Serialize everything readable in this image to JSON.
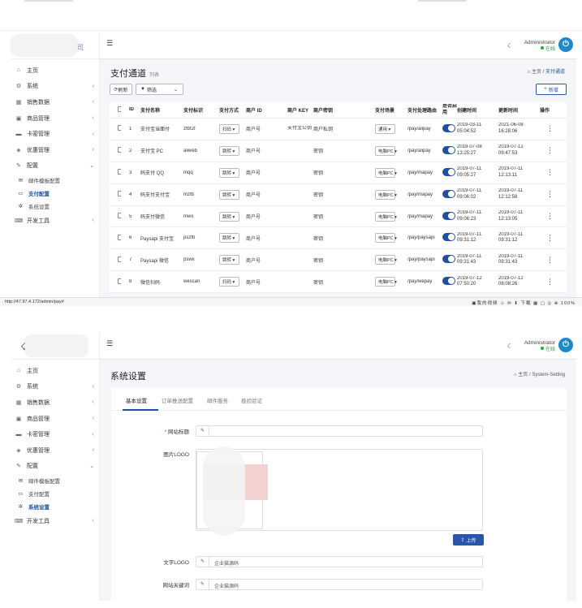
{
  "status_url": "http://47.97.4.172/admin/pay#",
  "status_right": "我的视频",
  "status_zoom_label": "下载",
  "zoom": "100%",
  "header": {
    "admin_name": "Administrator",
    "admin_status": "在线"
  },
  "sidebar": {
    "logo_char": "司",
    "items": [
      {
        "icon": "home-icon",
        "glyph": "⌂",
        "label": "主页"
      },
      {
        "icon": "gear-icon",
        "glyph": "⚙",
        "label": "系统"
      },
      {
        "icon": "table-icon",
        "glyph": "▦",
        "label": "销售数据"
      },
      {
        "icon": "box-icon",
        "glyph": "▣",
        "label": "商品管理"
      },
      {
        "icon": "card-icon",
        "glyph": "▬",
        "label": "卡密管理"
      },
      {
        "icon": "gem-icon",
        "glyph": "◈",
        "label": "优惠管理"
      },
      {
        "icon": "wrench-icon",
        "glyph": "✎",
        "label": "配置"
      }
    ],
    "subitems": [
      {
        "icon": "mail-icon",
        "glyph": "✉",
        "label": "邮件模板配置"
      },
      {
        "icon": "pay-icon",
        "glyph": "▭",
        "label": "支付配置"
      },
      {
        "icon": "cogs-icon",
        "glyph": "✲",
        "label": "系统设置"
      }
    ],
    "devtools": {
      "icon": "keyboard-icon",
      "glyph": "⌨",
      "label": "开发工具"
    }
  },
  "pay": {
    "title": "支付通道",
    "subtitle": "列表",
    "crumb_home": "主页",
    "crumb_current": "支付通道",
    "refresh": "刷新",
    "filter": "筛选",
    "add": "新增",
    "columns": [
      "ID",
      "支付名称",
      "支付标识",
      "支付方式",
      "商户 ID",
      "商户 KEY",
      "商户密钥",
      "支付场景",
      "支付处理路由",
      "是否启用",
      "创建时间",
      "更新时间",
      "操作"
    ],
    "rows": [
      {
        "id": "1",
        "name": "支付宝当面付",
        "code": "zfbf2f",
        "method": "扫码",
        "mid": "商户号",
        "key": "支付宝公钥",
        "secret": "商户私钥",
        "scene": "通用",
        "route": "/pay/alipay",
        "created": "2019-03-11 05:04:52",
        "updated": "2021-06-08 16:28:06"
      },
      {
        "id": "2",
        "name": "支付宝 PC",
        "code": "aliweb",
        "method": "跳转",
        "mid": "商户号",
        "key": "",
        "secret": "密钥",
        "scene": "电脑PC",
        "route": "/pay/alipay",
        "created": "2019-07-08 13:25:27",
        "updated": "2019-07-12 09:47:53"
      },
      {
        "id": "3",
        "name": "码支付 QQ",
        "code": "mqq",
        "method": "跳转",
        "mid": "商户号",
        "key": "",
        "secret": "密钥",
        "scene": "电脑PC",
        "route": "/pay/mapay",
        "created": "2019-07-11 09:05:27",
        "updated": "2019-07-11 12:13:11"
      },
      {
        "id": "4",
        "name": "码支付支付宝",
        "code": "mzfb",
        "method": "跳转",
        "mid": "商户号",
        "key": "",
        "secret": "密钥",
        "scene": "电脑PC",
        "route": "/pay/mapay",
        "created": "2019-07-11 09:06:02",
        "updated": "2019-07-11 12:12:58"
      },
      {
        "id": "5",
        "name": "码支付微信",
        "code": "mwx",
        "method": "跳转",
        "mid": "商户号",
        "key": "",
        "secret": "密钥",
        "scene": "电脑PC",
        "route": "/pay/mapay",
        "created": "2019-07-11 09:06:23",
        "updated": "2019-07-11 12:13:05"
      },
      {
        "id": "6",
        "name": "Paysapi 支付宝",
        "code": "pszfb",
        "method": "跳转",
        "mid": "商户号",
        "key": "",
        "secret": "密钥",
        "scene": "电脑PC",
        "route": "/pay/paysapi",
        "created": "2019-07-11 09:31:12",
        "updated": "2019-07-11 09:31:12"
      },
      {
        "id": "7",
        "name": "Paysapi 微信",
        "code": "pswx",
        "method": "跳转",
        "mid": "商户号",
        "key": "",
        "secret": "密钥",
        "scene": "电脑PC",
        "route": "/pay/paysapi",
        "created": "2019-07-11 09:31:43",
        "updated": "2019-07-11 09:31:43"
      },
      {
        "id": "8",
        "name": "微信扫码",
        "code": "wescan",
        "method": "扫码",
        "mid": "商户号",
        "key": "",
        "secret": "密钥",
        "scene": "电脑PC",
        "route": "/pay/wepay",
        "created": "2019-07-12 07:50:20",
        "updated": "2019-07-12 08:08:26"
      }
    ]
  },
  "settings": {
    "title": "系统设置",
    "crumb_home": "主页",
    "crumb_current": "System-Setting",
    "tabs": [
      "基本设置",
      "订单推送配置",
      "邮件服务",
      "极验验证"
    ],
    "site_title_label": "网站标题",
    "logo_label": "图片LOGO",
    "upload": "上传",
    "text_logo_label": "文字LOGO",
    "text_logo_value": "企业猫源码",
    "keywords_label": "网站关键词",
    "keywords_value": "企业猫源码"
  }
}
